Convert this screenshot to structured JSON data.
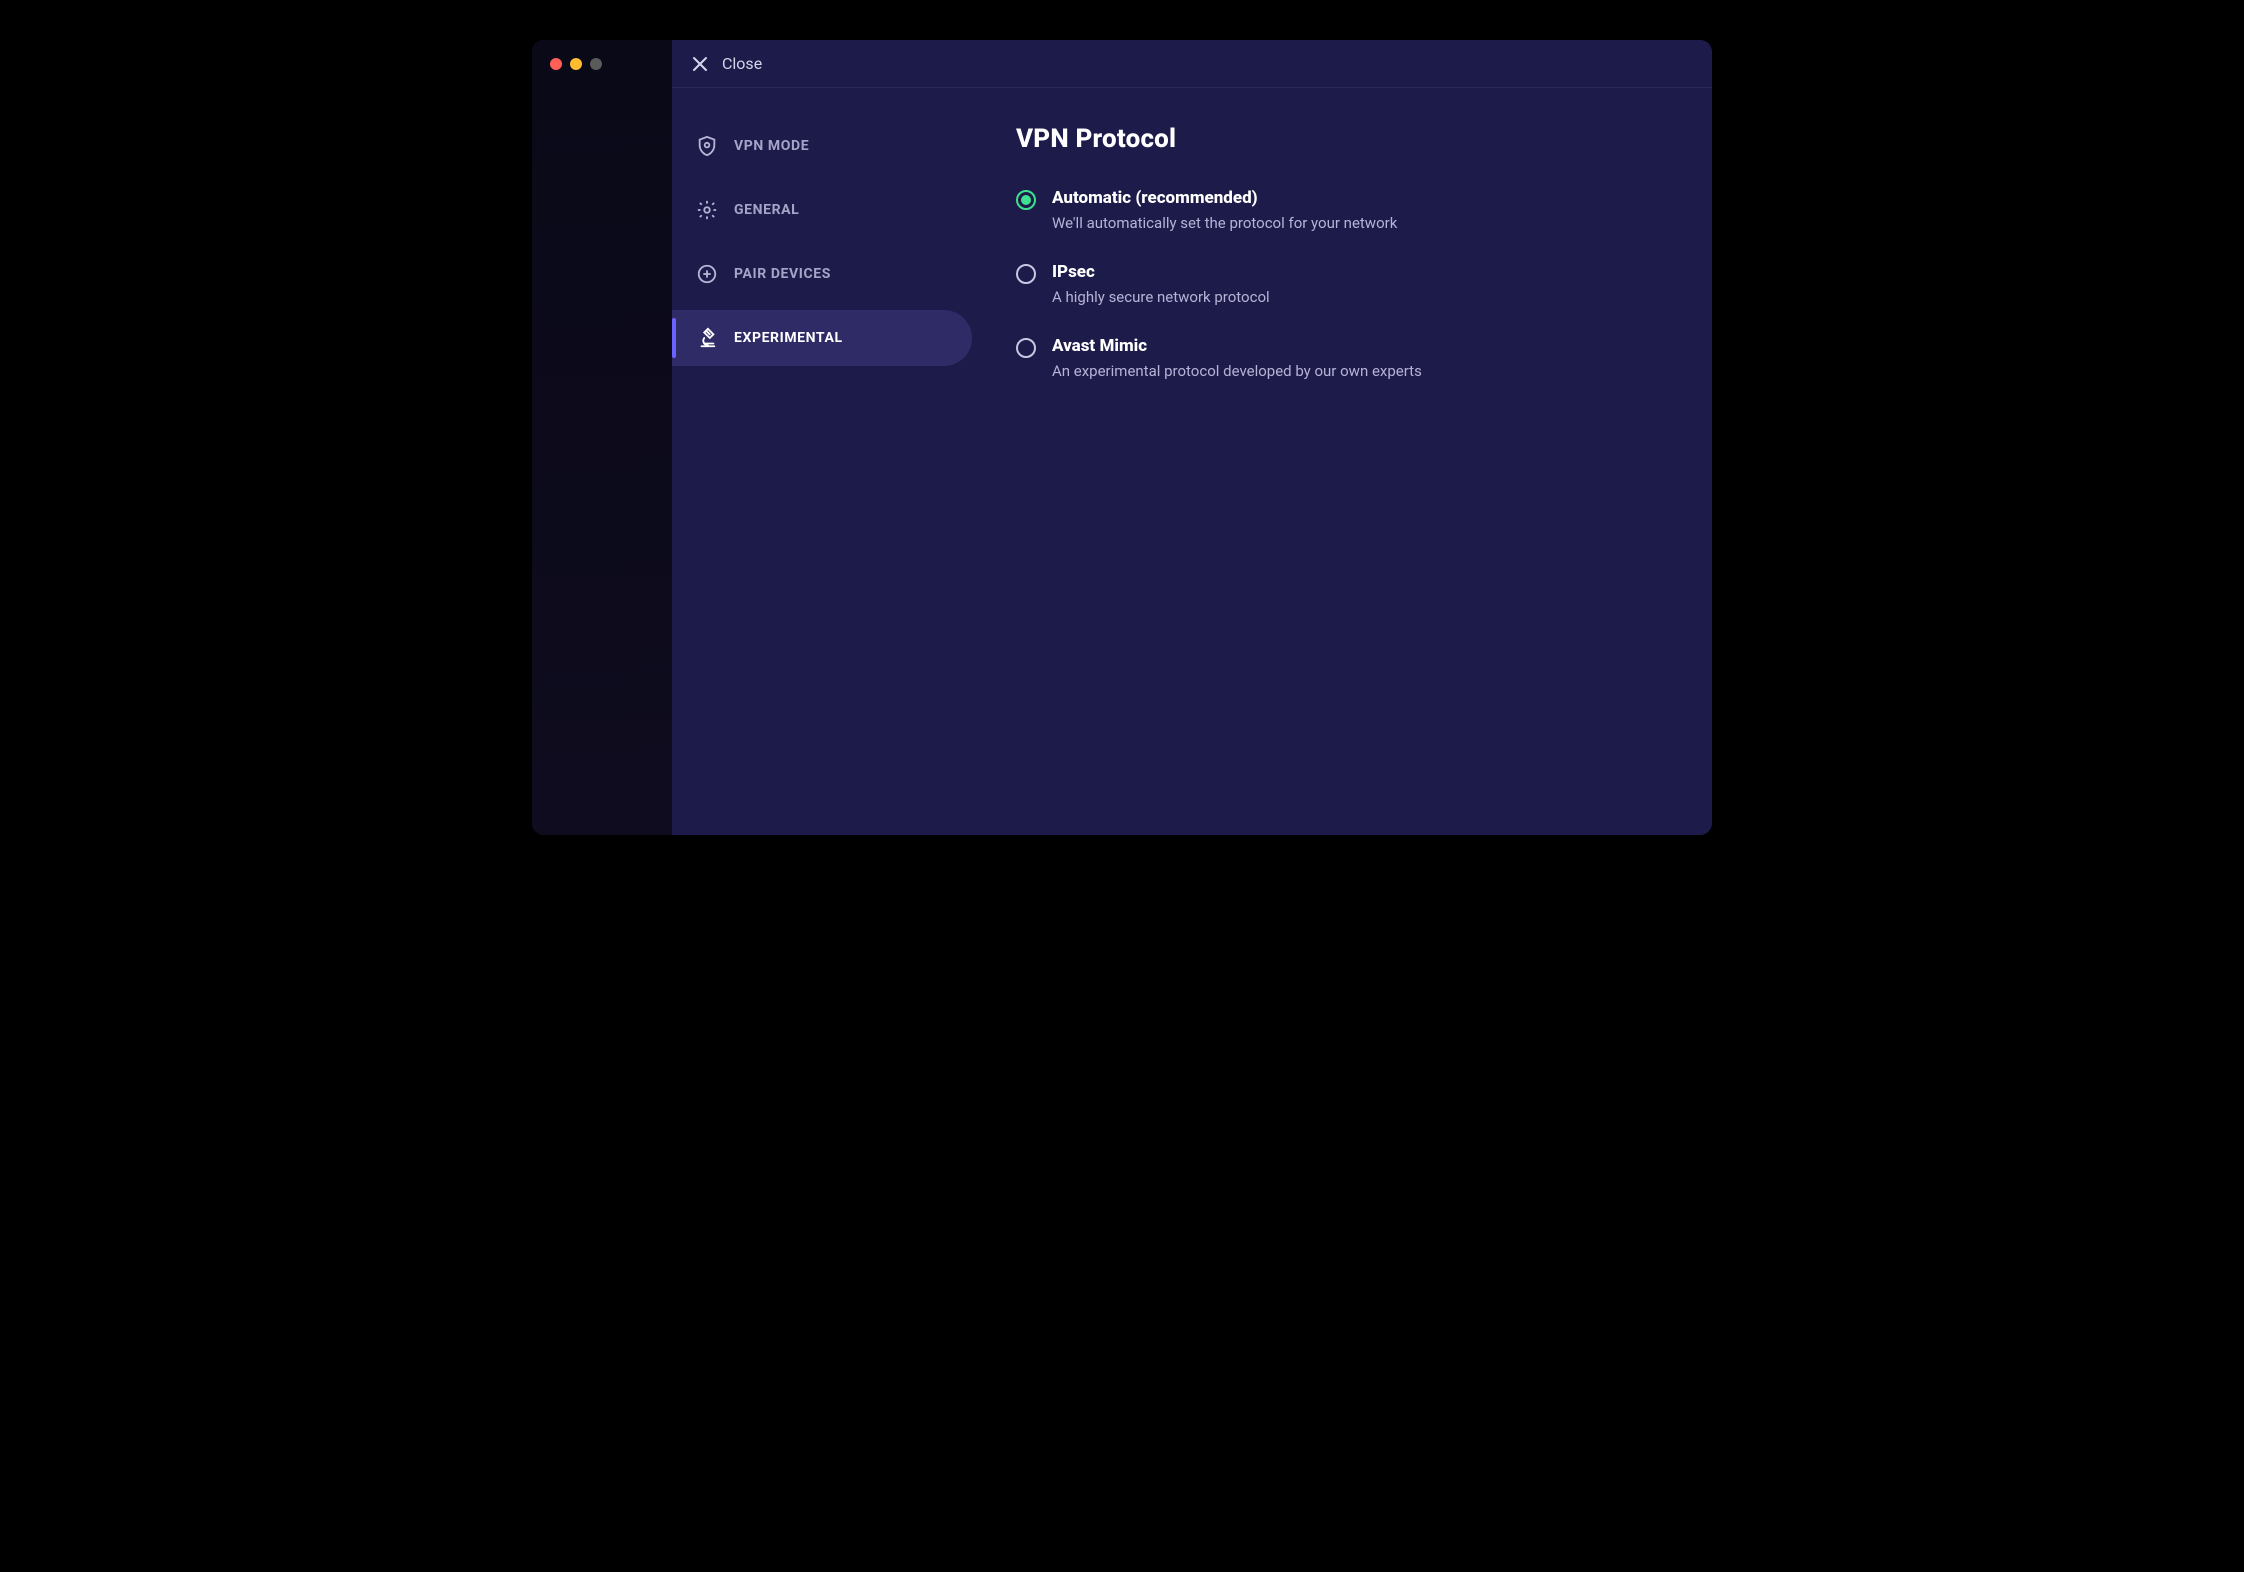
{
  "topbar": {
    "close_label": "Close"
  },
  "sidebar": {
    "items": [
      {
        "label": "VPN MODE"
      },
      {
        "label": "GENERAL"
      },
      {
        "label": "PAIR DEVICES"
      },
      {
        "label": "EXPERIMENTAL"
      }
    ]
  },
  "main": {
    "title": "VPN Protocol",
    "options": [
      {
        "title": "Automatic (recommended)",
        "desc": "We'll automatically set the protocol for your network",
        "selected": true
      },
      {
        "title": "IPsec",
        "desc": "A highly secure network protocol",
        "selected": false
      },
      {
        "title": "Avast Mimic",
        "desc": "An experimental protocol developed by our own experts",
        "selected": false
      }
    ]
  }
}
